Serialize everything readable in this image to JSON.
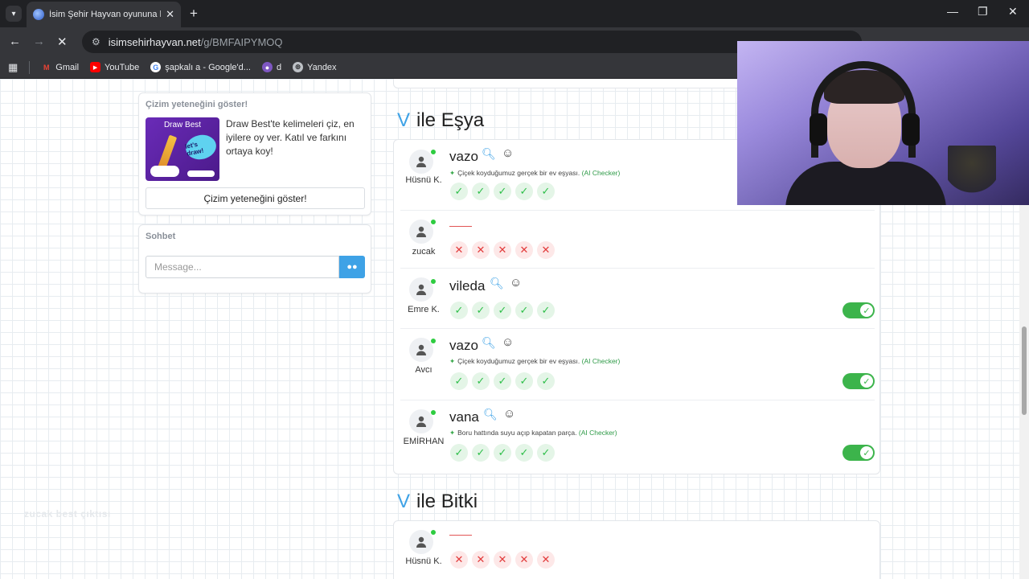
{
  "browser": {
    "tab_title": "İsim Şehir Hayvan oyununa katıl",
    "tab_close": "✕",
    "new_tab": "+",
    "url_host": "isimsehirhayvan.net",
    "url_path": "/g/BMFAIPYMOQ",
    "bookmarks": [
      {
        "label": "Gmail",
        "icon": "gmail-icon",
        "color": "#ea4335"
      },
      {
        "label": "YouTube",
        "icon": "youtube-icon",
        "color": "#ff0000"
      },
      {
        "label": "şapkalı a - Google'd...",
        "icon": "google-icon",
        "color": "#4285f4"
      },
      {
        "label": "d",
        "icon": "site-icon",
        "color": "#7e57c2"
      },
      {
        "label": "Yandex",
        "icon": "yandex-icon",
        "color": "#bdc1c6"
      }
    ]
  },
  "sidebar": {
    "draw_card": {
      "heading": "Çizim yeteneğini göster!",
      "thumb_title": "Draw Best",
      "thumb_badge": "let's draw!",
      "text": "Draw Best'te kelimeleri çiz, en iyilere oy ver. Katıl ve farkını ortaya koy!",
      "button": "Çizim yeteneğini göster!"
    },
    "chat": {
      "heading": "Sohbet",
      "placeholder": "Message...",
      "send_icon": "chat-icon"
    },
    "watermark": "zucak best çıktısı"
  },
  "sections": [
    {
      "letter": "V",
      "category": "ile Eşya",
      "rows": [
        {
          "user": "Hüsnü K.",
          "word": "vazo",
          "desc": "Çiçek koyduğumuz gerçek bir ev eşyası.",
          "ai": "(AI Checker)",
          "votes": [
            "ok",
            "ok",
            "ok",
            "ok",
            "ok"
          ],
          "toggle": false
        },
        {
          "user": "zucak",
          "word": "",
          "desc": "",
          "ai": "",
          "votes": [
            "no",
            "no",
            "no",
            "no",
            "no"
          ],
          "toggle": false
        },
        {
          "user": "Emre K.",
          "word": "vileda",
          "desc": "",
          "ai": "",
          "votes": [
            "ok",
            "ok",
            "ok",
            "ok",
            "ok"
          ],
          "toggle": true
        },
        {
          "user": "Avcı",
          "word": "vazo",
          "desc": "Çiçek koyduğumuz gerçek bir ev eşyası.",
          "ai": "(AI Checker)",
          "votes": [
            "ok",
            "ok",
            "ok",
            "ok",
            "ok"
          ],
          "toggle": true
        },
        {
          "user": "EMİRHAN",
          "word": "vana",
          "desc": "Boru hattında suyu açıp kapatan parça.",
          "ai": "(AI Checker)",
          "votes": [
            "ok",
            "ok",
            "ok",
            "ok",
            "ok"
          ],
          "toggle": true
        }
      ]
    },
    {
      "letter": "V",
      "category": "ile Bitki",
      "rows": [
        {
          "user": "Hüsnü K.",
          "word": "",
          "desc": "",
          "ai": "",
          "votes": [
            "no",
            "no",
            "no",
            "no",
            "no"
          ],
          "toggle": false
        }
      ]
    }
  ],
  "colors": {
    "accent": "#3ea2e6",
    "ok": "#2fbf4a",
    "no": "#e23b3b",
    "toggle": "#3cb44b"
  }
}
